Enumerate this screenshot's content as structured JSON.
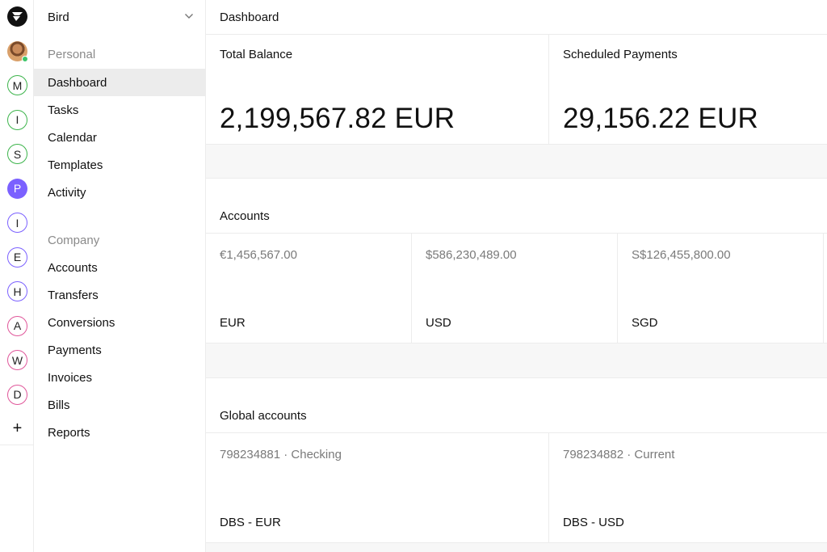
{
  "app": {
    "org_name": "Bird"
  },
  "rail": {
    "workspaces": [
      {
        "letter": "M",
        "color": "#3cb44b",
        "filled": false
      },
      {
        "letter": "I",
        "color": "#3cb44b",
        "filled": false
      },
      {
        "letter": "S",
        "color": "#3cb44b",
        "filled": false
      },
      {
        "letter": "P",
        "color": "#7b61ff",
        "filled": true
      },
      {
        "letter": "I",
        "color": "#7b61ff",
        "filled": false
      },
      {
        "letter": "E",
        "color": "#7b61ff",
        "filled": false
      },
      {
        "letter": "H",
        "color": "#7b61ff",
        "filled": false
      },
      {
        "letter": "A",
        "color": "#e0569a",
        "filled": false
      },
      {
        "letter": "W",
        "color": "#e0569a",
        "filled": false
      },
      {
        "letter": "D",
        "color": "#e0569a",
        "filled": false
      }
    ],
    "add_label": "+"
  },
  "sidebar": {
    "personal_label": "Personal",
    "personal_items": [
      "Dashboard",
      "Tasks",
      "Calendar",
      "Templates",
      "Activity"
    ],
    "company_label": "Company",
    "company_items": [
      "Accounts",
      "Transfers",
      "Conversions",
      "Payments",
      "Invoices",
      "Bills",
      "Reports"
    ],
    "active_item": "Dashboard"
  },
  "header": {
    "title": "Dashboard"
  },
  "summary": {
    "total_balance_label": "Total Balance",
    "total_balance_value": "2,199,567.82 EUR",
    "scheduled_label": "Scheduled Payments",
    "scheduled_value": "29,156.22 EUR"
  },
  "accounts": {
    "title": "Accounts",
    "items": [
      {
        "amount": "€1,456,567.00",
        "currency": "EUR"
      },
      {
        "amount": "$586,230,489.00",
        "currency": "USD"
      },
      {
        "amount": "S$126,455,800.00",
        "currency": "SGD"
      }
    ]
  },
  "global_accounts": {
    "title": "Global accounts",
    "items": [
      {
        "number": "798234881 · Checking",
        "bank": "DBS - EUR"
      },
      {
        "number": "798234882 · Current",
        "bank": "DBS - USD"
      }
    ]
  },
  "colors": {
    "active_bg": "#ececec",
    "border": "#ececec",
    "band": "#f7f7f7",
    "online": "#3cc56a"
  }
}
